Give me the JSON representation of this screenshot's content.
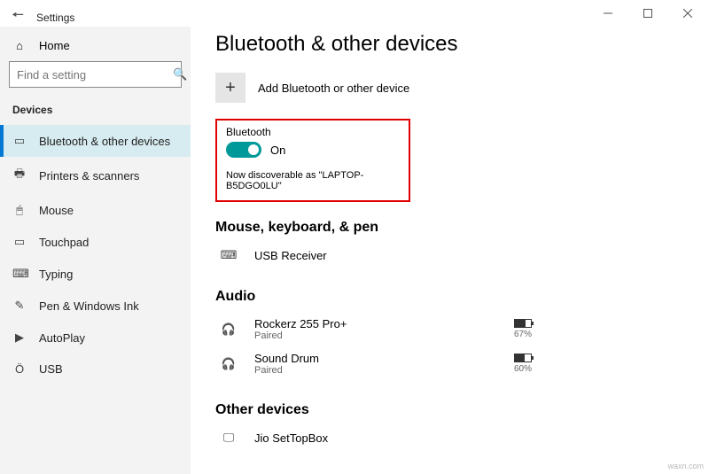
{
  "window": {
    "title": "Settings"
  },
  "sidebar": {
    "home": "Home",
    "searchPlaceholder": "Find a setting",
    "sectionLabel": "Devices",
    "items": [
      {
        "label": "Bluetooth & other devices"
      },
      {
        "label": "Printers & scanners"
      },
      {
        "label": "Mouse"
      },
      {
        "label": "Touchpad"
      },
      {
        "label": "Typing"
      },
      {
        "label": "Pen & Windows Ink"
      },
      {
        "label": "AutoPlay"
      },
      {
        "label": "USB"
      }
    ]
  },
  "page": {
    "title": "Bluetooth & other devices",
    "addLabel": "Add Bluetooth or other device",
    "bluetooth": {
      "label": "Bluetooth",
      "state": "On",
      "discoverable": "Now discoverable as \"LAPTOP-B5DGO0LU\""
    },
    "sections": {
      "mkp": {
        "title": "Mouse, keyboard, & pen",
        "items": [
          {
            "name": "USB Receiver"
          }
        ]
      },
      "audio": {
        "title": "Audio",
        "items": [
          {
            "name": "Rockerz 255 Pro+",
            "status": "Paired",
            "battery": "67%",
            "fill": 67
          },
          {
            "name": "Sound Drum",
            "status": "Paired",
            "battery": "60%",
            "fill": 60
          }
        ]
      },
      "other": {
        "title": "Other devices",
        "items": [
          {
            "name": "Jio SetTopBox"
          }
        ]
      }
    }
  },
  "watermark": "waxn.com"
}
